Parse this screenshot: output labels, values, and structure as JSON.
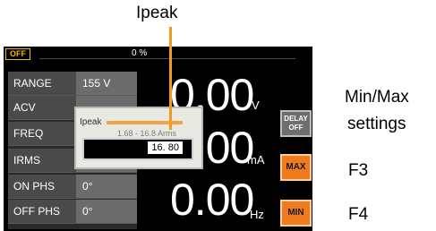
{
  "callouts": {
    "ipeak": "Ipeak",
    "minmax_line1": "Min/Max",
    "minmax_line2": "settings",
    "f3": "F3",
    "f4": "F4"
  },
  "status": {
    "output_state": "OFF",
    "percent": "0 %"
  },
  "params": [
    {
      "label": "RANGE",
      "value": "155 V"
    },
    {
      "label": "ACV",
      "value": ""
    },
    {
      "label": "FREQ",
      "value": ""
    },
    {
      "label": "IRMS",
      "value": ""
    },
    {
      "label": "ON PHS",
      "value": "0°"
    },
    {
      "label": "OFF PHS",
      "value": "0°"
    }
  ],
  "readings": {
    "voltage": {
      "value": "0.00",
      "unit": "V"
    },
    "current": {
      "value": "0.00",
      "unit": "mA"
    },
    "frequency": {
      "value": "0.00",
      "unit": "Hz"
    }
  },
  "softkeys": {
    "delay_line1": "DELAY",
    "delay_line2": "OFF",
    "max": "MAX",
    "min": "MIN"
  },
  "popup": {
    "title": "Ipeak",
    "range": "1.68 - 16.8 Arms",
    "value": "16. 80"
  },
  "colors": {
    "accent_orange": "#f07a1e",
    "status_yellow": "#f1b90a",
    "screen_bg": "#000000"
  }
}
